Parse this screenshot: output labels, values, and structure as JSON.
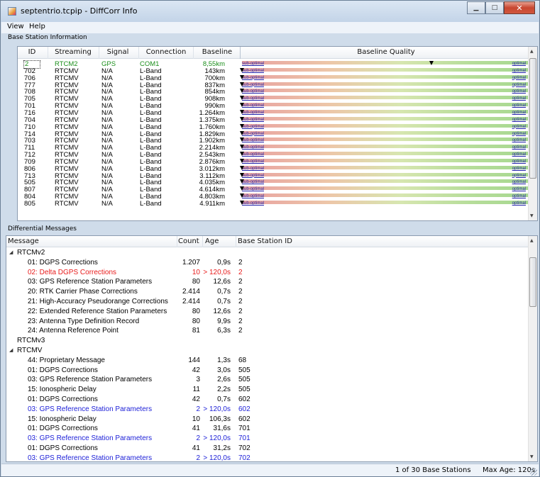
{
  "window": {
    "title": "septentrio.tcpip - DiffCorr Info",
    "buttons": [
      "minimize",
      "maximize",
      "close"
    ]
  },
  "menu": [
    {
      "label": "View"
    },
    {
      "label": "Help"
    }
  ],
  "base_station_group": {
    "label": "Base Station Information"
  },
  "base_table": {
    "columns": [
      "ID",
      "Streaming",
      "Signal",
      "Connection",
      "Baseline",
      "Baseline Quality"
    ],
    "quality_labels": {
      "left": "sub-optimal",
      "right": "optimal"
    },
    "rows": [
      {
        "id": "2",
        "streaming": "RTCM2",
        "signal": "GPS",
        "connection": "COM1",
        "baseline": "8,55km",
        "highlight": true,
        "quality": 0.66
      },
      {
        "id": "702",
        "streaming": "RTCMV",
        "signal": "N/A",
        "connection": "L-Band",
        "baseline": "143km",
        "quality": 0.0
      },
      {
        "id": "706",
        "streaming": "RTCMV",
        "signal": "N/A",
        "connection": "L-Band",
        "baseline": "700km",
        "quality": 0.0
      },
      {
        "id": "777",
        "streaming": "RTCMV",
        "signal": "N/A",
        "connection": "L-Band",
        "baseline": "837km",
        "quality": 0.0
      },
      {
        "id": "708",
        "streaming": "RTCMV",
        "signal": "N/A",
        "connection": "L-Band",
        "baseline": "854km",
        "quality": 0.0
      },
      {
        "id": "705",
        "streaming": "RTCMV",
        "signal": "N/A",
        "connection": "L-Band",
        "baseline": "908km",
        "quality": 0.0
      },
      {
        "id": "701",
        "streaming": "RTCMV",
        "signal": "N/A",
        "connection": "L-Band",
        "baseline": "990km",
        "quality": 0.0
      },
      {
        "id": "716",
        "streaming": "RTCMV",
        "signal": "N/A",
        "connection": "L-Band",
        "baseline": "1.264km",
        "quality": 0.0
      },
      {
        "id": "704",
        "streaming": "RTCMV",
        "signal": "N/A",
        "connection": "L-Band",
        "baseline": "1.375km",
        "quality": 0.0
      },
      {
        "id": "710",
        "streaming": "RTCMV",
        "signal": "N/A",
        "connection": "L-Band",
        "baseline": "1.760km",
        "quality": 0.0
      },
      {
        "id": "714",
        "streaming": "RTCMV",
        "signal": "N/A",
        "connection": "L-Band",
        "baseline": "1.829km",
        "quality": 0.0
      },
      {
        "id": "703",
        "streaming": "RTCMV",
        "signal": "N/A",
        "connection": "L-Band",
        "baseline": "1.902km",
        "quality": 0.0
      },
      {
        "id": "711",
        "streaming": "RTCMV",
        "signal": "N/A",
        "connection": "L-Band",
        "baseline": "2.214km",
        "quality": 0.0
      },
      {
        "id": "712",
        "streaming": "RTCMV",
        "signal": "N/A",
        "connection": "L-Band",
        "baseline": "2.543km",
        "quality": 0.0
      },
      {
        "id": "709",
        "streaming": "RTCMV",
        "signal": "N/A",
        "connection": "L-Band",
        "baseline": "2.876km",
        "quality": 0.0
      },
      {
        "id": "806",
        "streaming": "RTCMV",
        "signal": "N/A",
        "connection": "L-Band",
        "baseline": "3.012km",
        "quality": 0.0
      },
      {
        "id": "713",
        "streaming": "RTCMV",
        "signal": "N/A",
        "connection": "L-Band",
        "baseline": "3.112km",
        "quality": 0.0
      },
      {
        "id": "505",
        "streaming": "RTCMV",
        "signal": "N/A",
        "connection": "L-Band",
        "baseline": "4.035km",
        "quality": 0.0
      },
      {
        "id": "807",
        "streaming": "RTCMV",
        "signal": "N/A",
        "connection": "L-Band",
        "baseline": "4.614km",
        "quality": 0.0
      },
      {
        "id": "804",
        "streaming": "RTCMV",
        "signal": "N/A",
        "connection": "L-Band",
        "baseline": "4.803km",
        "quality": 0.0
      },
      {
        "id": "805",
        "streaming": "RTCMV",
        "signal": "N/A",
        "connection": "L-Band",
        "baseline": "4.911km",
        "quality": 0.0
      }
    ]
  },
  "diff_group": {
    "label": "Differential Messages"
  },
  "diff_table": {
    "columns": [
      "Message",
      "Count",
      "Age",
      "Base Station ID"
    ],
    "rows": [
      {
        "level": 0,
        "expander": "◢",
        "message": "RTCMv2"
      },
      {
        "level": 1,
        "message": "01: DGPS Corrections",
        "count": "1.207",
        "age": "0,9s",
        "base": "2"
      },
      {
        "level": 1,
        "message": "02: Delta DGPS Corrections",
        "count": "10",
        "age": "> 120,0s",
        "base": "2",
        "color": "red"
      },
      {
        "level": 1,
        "message": "03: GPS Reference Station Parameters",
        "count": "80",
        "age": "12,6s",
        "base": "2"
      },
      {
        "level": 1,
        "message": "20: RTK Carrier Phase Corrections",
        "count": "2.414",
        "age": "0,7s",
        "base": "2"
      },
      {
        "level": 1,
        "message": "21: High-Accuracy Pseudorange Corrections",
        "count": "2.414",
        "age": "0,7s",
        "base": "2"
      },
      {
        "level": 1,
        "message": "22: Extended Reference Station Parameters",
        "count": "80",
        "age": "12,6s",
        "base": "2"
      },
      {
        "level": 1,
        "message": "23: Antenna Type Definition Record",
        "count": "80",
        "age": "9,9s",
        "base": "2"
      },
      {
        "level": 1,
        "message": "24: Antenna Reference Point",
        "count": "81",
        "age": "6,3s",
        "base": "2"
      },
      {
        "level": 0,
        "expander": "",
        "message": "RTCMv3"
      },
      {
        "level": 0,
        "expander": "◢",
        "message": "RTCMV"
      },
      {
        "level": 1,
        "message": "44: Proprietary Message",
        "count": "144",
        "age": "1,3s",
        "base": "68"
      },
      {
        "level": 1,
        "message": "01: DGPS Corrections",
        "count": "42",
        "age": "3,0s",
        "base": "505"
      },
      {
        "level": 1,
        "message": "03: GPS Reference Station Parameters",
        "count": "3",
        "age": "2,6s",
        "base": "505"
      },
      {
        "level": 1,
        "message": "15: Ionospheric Delay",
        "count": "11",
        "age": "2,2s",
        "base": "505"
      },
      {
        "level": 1,
        "message": "01: DGPS Corrections",
        "count": "42",
        "age": "0,7s",
        "base": "602"
      },
      {
        "level": 1,
        "message": "03: GPS Reference Station Parameters",
        "count": "2",
        "age": "> 120,0s",
        "base": "602",
        "color": "blue"
      },
      {
        "level": 1,
        "message": "15: Ionospheric Delay",
        "count": "10",
        "age": "106,3s",
        "base": "602"
      },
      {
        "level": 1,
        "message": "01: DGPS Corrections",
        "count": "41",
        "age": "31,6s",
        "base": "701"
      },
      {
        "level": 1,
        "message": "03: GPS Reference Station Parameters",
        "count": "2",
        "age": "> 120,0s",
        "base": "701",
        "color": "blue"
      },
      {
        "level": 1,
        "message": "01: DGPS Corrections",
        "count": "41",
        "age": "31,2s",
        "base": "702"
      },
      {
        "level": 1,
        "message": "03: GPS Reference Station Parameters",
        "count": "2",
        "age": "> 120,0s",
        "base": "702",
        "color": "blue"
      }
    ]
  },
  "status": {
    "stations": "1 of 30 Base Stations",
    "max_age": "Max Age: 120s"
  },
  "colors": {
    "red": "#e81b1b",
    "blue": "#1f22d8",
    "green": "#1c8f1c"
  }
}
